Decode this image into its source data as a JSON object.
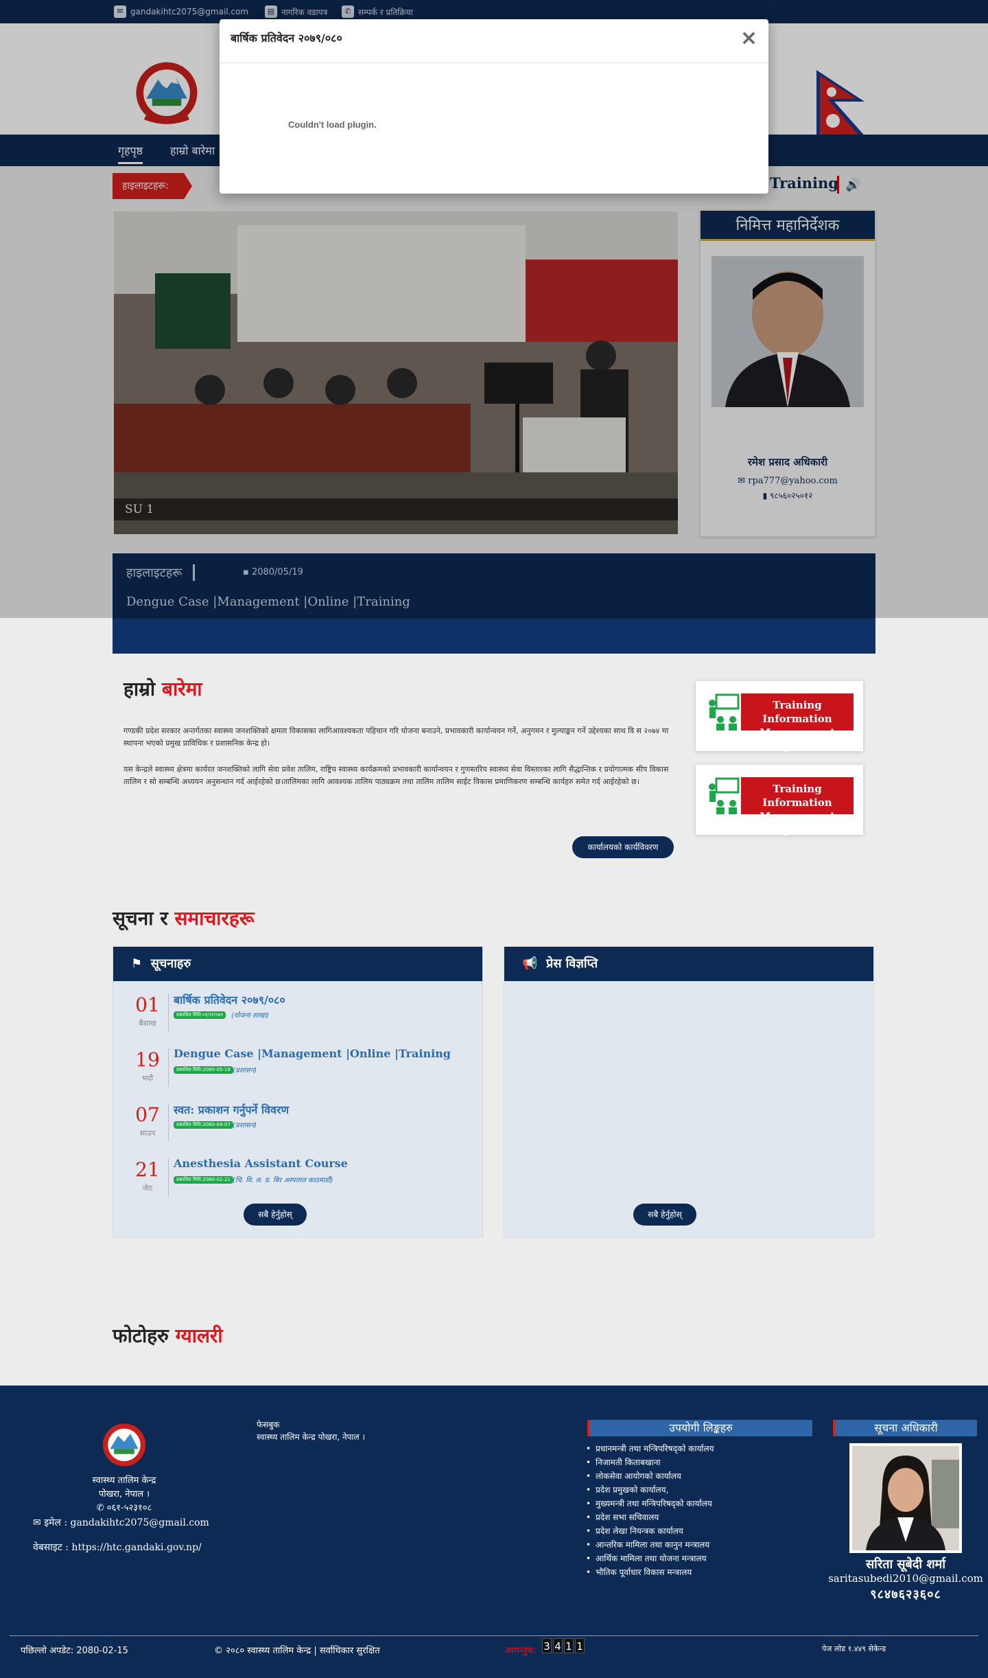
{
  "topbar": {
    "email": "gandakihtc2075@gmail.com",
    "charter": "नागरिक वडापत्र",
    "contact": "सम्पर्क र प्रतिक्रिया"
  },
  "nav": {
    "items": [
      "गृहपृष्ठ",
      "हाम्रो बारेमा"
    ]
  },
  "ticker": {
    "badge": "हाइलाइटहरू:",
    "text": "Training"
  },
  "slider": {
    "caption": "SU 1"
  },
  "dg": {
    "heading": "निमित्त महानिर्देशक",
    "name": "रमेश प्रसाद अधिकारी",
    "email": "rpa777@yahoo.com",
    "phone": "९८५६०२५०१२"
  },
  "highlights": {
    "title": "हाइलाइटहरू",
    "date": "2080/05/19",
    "text": "Dengue Case |Management |Online |Training"
  },
  "about": {
    "title_a": "हाम्रो",
    "title_b": "बारेमा",
    "p1": "गण्डकी प्रदेश सरकार अन्तर्गतका स्वास्थ्य जनशक्तिको क्षमता विकासका लागिआवश्यकता पहिचान गरि योजना बनाउने, प्रभावकारी कार्यान्वयन गर्ने, अनुगमन र मुल्याङ्कन गर्ने उद्देश्यका साथ वि स २०७४ मा स्थापना भएको प्रमुख प्राविधिक र प्रशासनिक केन्द्र हो।",
    "p2": "यस केन्द्रले स्वास्थ्य क्षेत्रमा कार्यरत जनशक्तिको लागि सेवा प्रवेश तालिम, राष्ट्रिय स्वास्थ्य कार्यक्रमको प्रभावकारी कार्यान्वयन र गुणस्तरिय स्वास्थ्य सेवा विस्तारका लागि सैद्धान्तिक र प्रयोगात्मक सीप विकास तालिम र सो सम्बन्धि अध्ययन अनुसन्धान गर्द आईरहेको छ।तालिमका लागि आवश्यक तालिम पाठ्यक्रम तथा तालिम तालिम साईट विकास प्रमाणिकरण सम्बन्धि कार्यहरु समेत गर्द आईरहेको छ।",
    "button": "कार्यालयको कार्यविवरण",
    "tims_label": "Training Information Management System"
  },
  "news": {
    "title_a": "सूचना र",
    "title_b": "समाचारहरू",
    "notices_head": "सूचनाहरु",
    "press_head": "प्रेस विज्ञप्ति",
    "view_all": "सबै हेर्नुहोस्",
    "notices": [
      {
        "day": "01",
        "month": "बैशाख",
        "title": "बार्षिक प्रतिवेदन २०७९/०८०",
        "tag": "प्रकाशित मिति:०१/२१/०७९",
        "category": "(योजना शाखा)"
      },
      {
        "day": "19",
        "month": "भदौ",
        "title": "Dengue Case |Management |Online |Training",
        "tag": "प्रकाशित मिति:2080-05-19",
        "category": "(प्रशासन)"
      },
      {
        "day": "07",
        "month": "साउन",
        "title": "स्वत: प्रकाशन गर्नुपर्ने विवरण",
        "tag": "प्रकाशित मिति:2080-04-07",
        "category": "(प्रशासन)"
      },
      {
        "day": "21",
        "month": "जेठ",
        "title": "Anesthesia Assistant Course",
        "tag": "प्रकाशित मिति:2080-02-21",
        "category": "(चि. वि. ल. प्र. बिर अस्पताल काठमाडौं)"
      }
    ]
  },
  "gallery": {
    "title_a": "फोटोहरु",
    "title_b": "ग्यालरी"
  },
  "footer": {
    "org": "स्वास्थ्य तालिम केन्द्र",
    "address": "पोखरा, नेपाल ।",
    "phone": "०६१-५२३१०८",
    "email_label": "इमेल :",
    "email": "gandakihtc2075@gmail.com",
    "web_label": "वेबसाइट :",
    "website": "https://htc.gandaki.gov.np/",
    "facebook": "फेसबुक",
    "fb_org": "स्वास्थ्य तालिम केन्द्र पोखरा, नेपाल ।",
    "useful_head": "उपयोगी लिङ्कहरु",
    "useful_links": [
      "प्रधानमन्त्री तथा मन्त्रिपरिषद्को कार्यालय",
      "निजामती किताबखाना",
      "लोकसेवा आयोगको कार्यालय",
      "प्रदेश प्रमुखको कार्यालय,",
      "मुख्यमन्त्री तथा मन्त्रिपरिषद्को कार्यालय",
      "प्रदेश सभा सचिवालय",
      "प्रदेश लेखा नियन्त्रक कार्यालय",
      "आन्तरिक मामिला तथा कानुन मन्त्रालय",
      "आर्थिक मामिला तथा योजना मन्त्रालय",
      "भौतिक पूर्वाधार विकास मन्त्रालय"
    ],
    "info_head": "सूचना अधिकारी",
    "info_name": "सरिता सूबेदी शर्मा",
    "info_email": "saritasubedi2010@gmail.com",
    "info_phone": "९८४७६२३६०८",
    "last_update": "पछिल्लो अपडेट: 2080-02-15",
    "copyright": "© २०८० स्वास्थ्य तालिम केन्द्र | सर्वाधिकार सुरक्षित",
    "visitors_label": "आगन्तुक:",
    "visitors_digits": [
      "3",
      "4",
      "1",
      "1"
    ],
    "page_load": "पेज लोड १.४४९ सेकेन्ड"
  },
  "modal": {
    "title": "बार्षिक प्रतिवेदन २०७९/०८०",
    "message": "Couldn't load plugin."
  },
  "colors": {
    "navy": "#0d2a54",
    "accent_red": "#e0161d",
    "link_blue": "#2b6cb0",
    "tag_green": "#1fa64a"
  }
}
